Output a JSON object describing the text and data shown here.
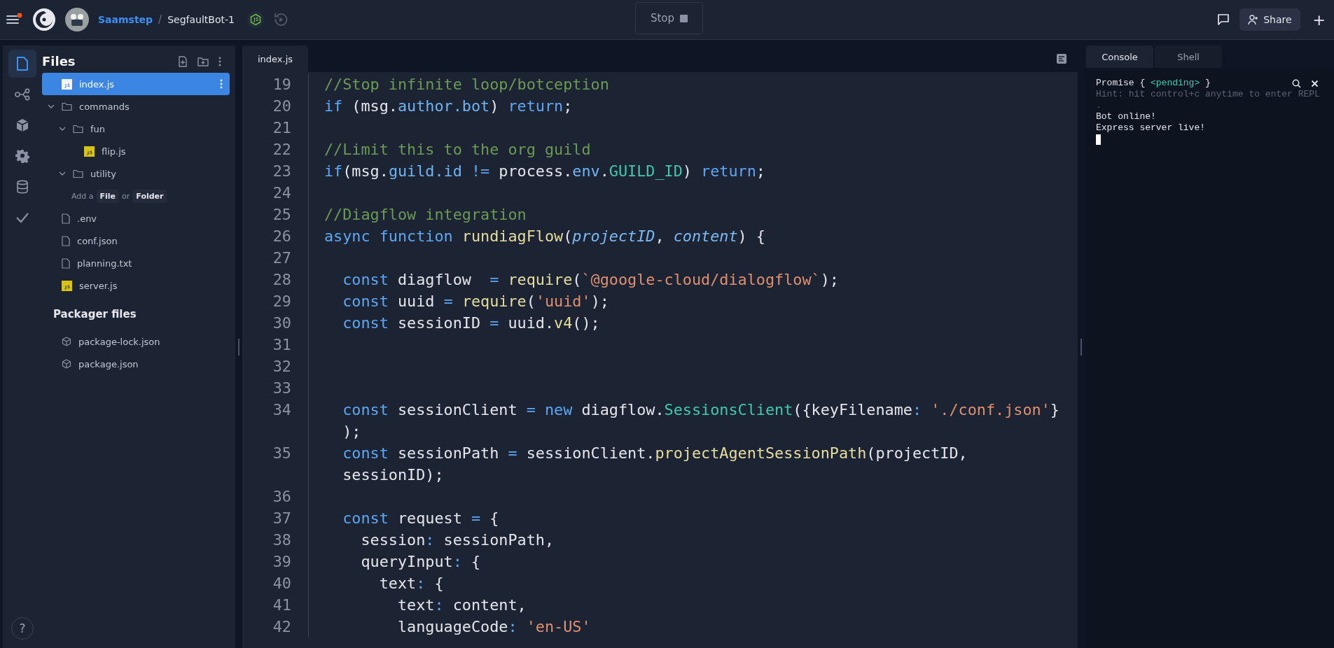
{
  "topbar": {
    "owner": "Saamstep",
    "separator": "/",
    "repl_name": "SegfaultBot-1",
    "run_button": "Stop",
    "share_button": "Share",
    "plus": "+"
  },
  "rail": [
    {
      "kind": "files",
      "selected": true
    },
    {
      "kind": "share",
      "selected": false
    },
    {
      "kind": "packages",
      "selected": false
    },
    {
      "kind": "settings",
      "selected": false
    },
    {
      "kind": "database",
      "selected": false
    },
    {
      "kind": "check",
      "selected": false
    }
  ],
  "help": "?",
  "files": {
    "title": "Files",
    "items": [
      {
        "kind": "js",
        "name": "index.js",
        "selected": true
      },
      {
        "kind": "folder",
        "name": "commands",
        "selected": false,
        "expanded": true,
        "children": [
          {
            "kind": "folder",
            "name": "fun",
            "selected": false,
            "expanded": true,
            "children": [
              {
                "kind": "js",
                "name": "flip.js",
                "selected": false
              }
            ]
          },
          {
            "kind": "folder",
            "name": "utility",
            "selected": false,
            "expanded": true,
            "empty_hint": {
              "prefix": "Add a",
              "file": "File",
              "or": "or",
              "folder": "Folder"
            }
          }
        ]
      },
      {
        "kind": "file",
        "name": ".env",
        "selected": false
      },
      {
        "kind": "file",
        "name": "conf.json",
        "selected": false
      },
      {
        "kind": "file",
        "name": "planning.txt",
        "selected": false
      },
      {
        "kind": "js",
        "name": "server.js",
        "selected": false
      }
    ]
  },
  "packager": {
    "title": "Packager files",
    "items": [
      {
        "kind": "package",
        "name": "package-lock.json",
        "selected": false
      },
      {
        "kind": "package",
        "name": "package.json",
        "selected": false
      }
    ]
  },
  "editor": {
    "tabs": [
      {
        "label": "index.js",
        "selected": true
      }
    ],
    "lines": [
      {
        "number": "19",
        "rows": [
          [
            {
              "kind": "comment",
              "text": "//Stop infinite loop/botception"
            }
          ]
        ]
      },
      {
        "number": "20",
        "rows": [
          [
            {
              "kind": "keyword",
              "text": "if"
            },
            {
              "kind": "plain",
              "text": " (msg."
            },
            {
              "kind": "property",
              "text": "author.bot"
            },
            {
              "kind": "plain",
              "text": ") "
            },
            {
              "kind": "keyword",
              "text": "return"
            },
            {
              "kind": "plain",
              "text": ";"
            }
          ]
        ]
      },
      {
        "number": "21",
        "rows": [
          []
        ]
      },
      {
        "number": "22",
        "rows": [
          [
            {
              "kind": "comment",
              "text": "//Limit this to the org guild"
            }
          ]
        ]
      },
      {
        "number": "23",
        "rows": [
          [
            {
              "kind": "keyword",
              "text": "if"
            },
            {
              "kind": "plain",
              "text": "(msg."
            },
            {
              "kind": "property",
              "text": "guild.id"
            },
            {
              "kind": "plain",
              "text": " "
            },
            {
              "kind": "keyword",
              "text": "!="
            },
            {
              "kind": "plain",
              "text": " process."
            },
            {
              "kind": "property",
              "text": "env"
            },
            {
              "kind": "plain",
              "text": "."
            },
            {
              "kind": "type",
              "text": "GUILD_ID"
            },
            {
              "kind": "plain",
              "text": ") "
            },
            {
              "kind": "keyword",
              "text": "return"
            },
            {
              "kind": "plain",
              "text": ";"
            }
          ]
        ]
      },
      {
        "number": "24",
        "rows": [
          []
        ]
      },
      {
        "number": "25",
        "rows": [
          [
            {
              "kind": "comment",
              "text": "//Diagflow integration"
            }
          ]
        ]
      },
      {
        "number": "26",
        "rows": [
          [
            {
              "kind": "keyword",
              "text": "async function"
            },
            {
              "kind": "plain",
              "text": " "
            },
            {
              "kind": "function",
              "text": "rundiagFlow"
            },
            {
              "kind": "plain",
              "text": "("
            },
            {
              "kind": "param",
              "text": "projectID"
            },
            {
              "kind": "plain",
              "text": ", "
            },
            {
              "kind": "param",
              "text": "content"
            },
            {
              "kind": "plain",
              "text": ") {"
            }
          ]
        ]
      },
      {
        "number": "27",
        "rows": [
          []
        ]
      },
      {
        "number": "28",
        "rows": [
          [
            {
              "kind": "keyword",
              "text": "  const"
            },
            {
              "kind": "plain",
              "text": " diagflow  "
            },
            {
              "kind": "keyword",
              "text": "="
            },
            {
              "kind": "plain",
              "text": " "
            },
            {
              "kind": "function",
              "text": "require"
            },
            {
              "kind": "plain",
              "text": "("
            },
            {
              "kind": "string",
              "text": "`@google-cloud/dialogflow`"
            },
            {
              "kind": "plain",
              "text": ");"
            }
          ]
        ]
      },
      {
        "number": "29",
        "rows": [
          [
            {
              "kind": "keyword",
              "text": "  const"
            },
            {
              "kind": "plain",
              "text": " uuid "
            },
            {
              "kind": "keyword",
              "text": "="
            },
            {
              "kind": "plain",
              "text": " "
            },
            {
              "kind": "function",
              "text": "require"
            },
            {
              "kind": "plain",
              "text": "("
            },
            {
              "kind": "string",
              "text": "'uuid'"
            },
            {
              "kind": "plain",
              "text": ");"
            }
          ]
        ]
      },
      {
        "number": "30",
        "rows": [
          [
            {
              "kind": "keyword",
              "text": "  const"
            },
            {
              "kind": "plain",
              "text": " sessionID "
            },
            {
              "kind": "keyword",
              "text": "="
            },
            {
              "kind": "plain",
              "text": " uuid."
            },
            {
              "kind": "function",
              "text": "v4"
            },
            {
              "kind": "plain",
              "text": "();"
            }
          ]
        ]
      },
      {
        "number": "31",
        "rows": [
          []
        ]
      },
      {
        "number": "32",
        "rows": [
          []
        ]
      },
      {
        "number": "33",
        "rows": [
          []
        ]
      },
      {
        "number": "34",
        "rows": [
          [
            {
              "kind": "keyword",
              "text": "  const"
            },
            {
              "kind": "plain",
              "text": " sessionClient "
            },
            {
              "kind": "keyword",
              "text": "="
            },
            {
              "kind": "plain",
              "text": " "
            },
            {
              "kind": "keyword",
              "text": "new"
            },
            {
              "kind": "plain",
              "text": " diagflow."
            },
            {
              "kind": "type",
              "text": "SessionsClient"
            },
            {
              "kind": "plain",
              "text": "({keyFilename"
            },
            {
              "kind": "keyword",
              "text": ":"
            },
            {
              "kind": "plain",
              "text": " "
            },
            {
              "kind": "string",
              "text": "'./conf.json'"
            },
            {
              "kind": "plain",
              "text": "}"
            }
          ],
          [
            {
              "kind": "plain",
              "text": "  );"
            }
          ]
        ]
      },
      {
        "number": "35",
        "rows": [
          [
            {
              "kind": "keyword",
              "text": "  const"
            },
            {
              "kind": "plain",
              "text": " sessionPath "
            },
            {
              "kind": "keyword",
              "text": "="
            },
            {
              "kind": "plain",
              "text": " sessionClient."
            },
            {
              "kind": "function",
              "text": "projectAgentSessionPath"
            },
            {
              "kind": "plain",
              "text": "(projectID,"
            }
          ],
          [
            {
              "kind": "plain",
              "text": "  sessionID);"
            }
          ]
        ]
      },
      {
        "number": "36",
        "rows": [
          []
        ]
      },
      {
        "number": "37",
        "rows": [
          [
            {
              "kind": "keyword",
              "text": "  const"
            },
            {
              "kind": "plain",
              "text": " request "
            },
            {
              "kind": "keyword",
              "text": "="
            },
            {
              "kind": "plain",
              "text": " {"
            }
          ]
        ]
      },
      {
        "number": "38",
        "rows": [
          [
            {
              "kind": "plain",
              "text": "    session"
            },
            {
              "kind": "keyword",
              "text": ":"
            },
            {
              "kind": "plain",
              "text": " sessionPath,"
            }
          ]
        ]
      },
      {
        "number": "39",
        "rows": [
          [
            {
              "kind": "plain",
              "text": "    queryInput"
            },
            {
              "kind": "keyword",
              "text": ":"
            },
            {
              "kind": "plain",
              "text": " {"
            }
          ]
        ]
      },
      {
        "number": "40",
        "rows": [
          [
            {
              "kind": "plain",
              "text": "      text"
            },
            {
              "kind": "keyword",
              "text": ":"
            },
            {
              "kind": "plain",
              "text": " {"
            }
          ]
        ]
      },
      {
        "number": "41",
        "rows": [
          [
            {
              "kind": "plain",
              "text": "        text"
            },
            {
              "kind": "keyword",
              "text": ":"
            },
            {
              "kind": "plain",
              "text": " content,"
            }
          ]
        ]
      },
      {
        "number": "42",
        "rows": [
          [
            {
              "kind": "plain",
              "text": "        languageCode"
            },
            {
              "kind": "keyword",
              "text": ":"
            },
            {
              "kind": "plain",
              "text": " "
            },
            {
              "kind": "string",
              "text": "'en-US'"
            }
          ]
        ]
      }
    ]
  },
  "console": {
    "tabs": [
      {
        "label": "Console",
        "selected": true
      },
      {
        "label": "Shell",
        "selected": false
      }
    ],
    "lines": [
      [
        {
          "kind": "plain",
          "text": "Promise { "
        },
        {
          "kind": "type",
          "text": "<pending>"
        },
        {
          "kind": "plain",
          "text": " }"
        }
      ],
      [
        {
          "kind": "hint",
          "text": "Hint: hit control+c anytime to enter REPL"
        }
      ],
      [
        {
          "kind": "hint",
          "text": "."
        }
      ],
      [
        {
          "kind": "plain",
          "text": "Bot online!"
        }
      ],
      [
        {
          "kind": "plain",
          "text": "Express server live!"
        }
      ]
    ]
  }
}
